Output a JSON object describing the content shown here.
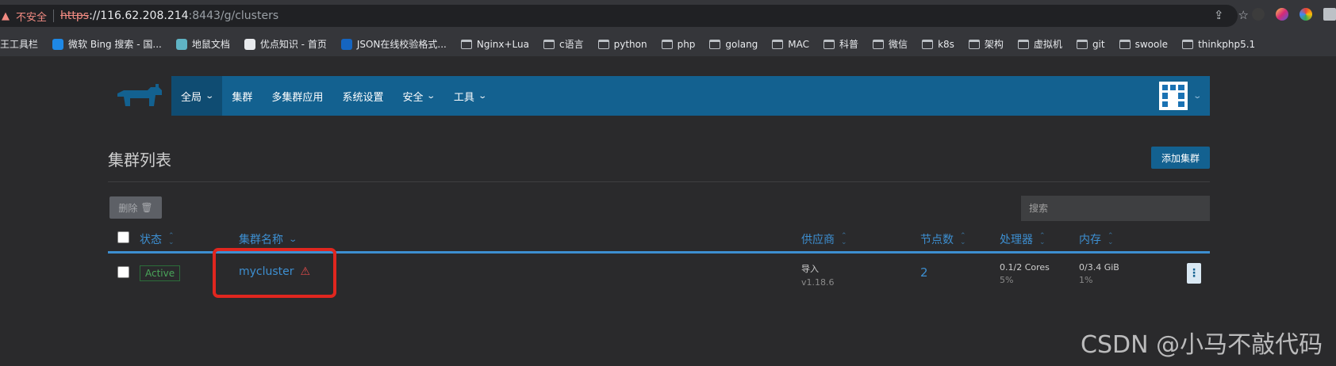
{
  "browser": {
    "insecure_label": "不安全",
    "url_scheme": "https",
    "url_host": "://116.62.208.214",
    "url_rest": ":8443/g/clusters",
    "bookmarks": [
      {
        "label": "王工具栏",
        "icon": "folder"
      },
      {
        "label": "微软 Bing 搜索 - 国...",
        "icon": "bing"
      },
      {
        "label": "地鼠文档",
        "icon": "gopher"
      },
      {
        "label": "优点知识 - 首页",
        "icon": "youdian"
      },
      {
        "label": "JSON在线校验格式...",
        "icon": "bejson"
      },
      {
        "label": "Nginx+Lua",
        "icon": "folder"
      },
      {
        "label": "c语言",
        "icon": "folder"
      },
      {
        "label": "python",
        "icon": "folder"
      },
      {
        "label": "php",
        "icon": "folder"
      },
      {
        "label": "golang",
        "icon": "folder"
      },
      {
        "label": "MAC",
        "icon": "folder"
      },
      {
        "label": "科普",
        "icon": "folder"
      },
      {
        "label": "微信",
        "icon": "folder"
      },
      {
        "label": "k8s",
        "icon": "folder"
      },
      {
        "label": "架构",
        "icon": "folder"
      },
      {
        "label": "虚拟机",
        "icon": "folder"
      },
      {
        "label": "git",
        "icon": "folder"
      },
      {
        "label": "swoole",
        "icon": "folder"
      },
      {
        "label": "thinkphp5.1",
        "icon": "folder"
      }
    ]
  },
  "header": {
    "nav": [
      {
        "label": "全局",
        "dropdown": true,
        "active": true
      },
      {
        "label": "集群",
        "dropdown": false
      },
      {
        "label": "多集群应用",
        "dropdown": false
      },
      {
        "label": "系统设置",
        "dropdown": false
      },
      {
        "label": "安全",
        "dropdown": true
      },
      {
        "label": "工具",
        "dropdown": true
      }
    ],
    "brand_color": "#136190"
  },
  "page": {
    "title": "集群列表",
    "add_button": "添加集群",
    "delete_button": "删除",
    "search_placeholder": "搜索"
  },
  "table": {
    "columns": {
      "state": "状态",
      "name": "集群名称",
      "provider": "供应商",
      "nodes": "节点数",
      "cpu": "处理器",
      "memory": "内存"
    },
    "rows": [
      {
        "state": "Active",
        "name": "mycluster",
        "provider": "导入",
        "version": "v1.18.6",
        "nodes": "2",
        "cpu": "0.1/2 Cores",
        "cpu_pct": "5%",
        "memory": "0/3.4 GiB",
        "memory_pct": "1%"
      }
    ]
  },
  "watermark": "CSDN @小马不敲代码"
}
